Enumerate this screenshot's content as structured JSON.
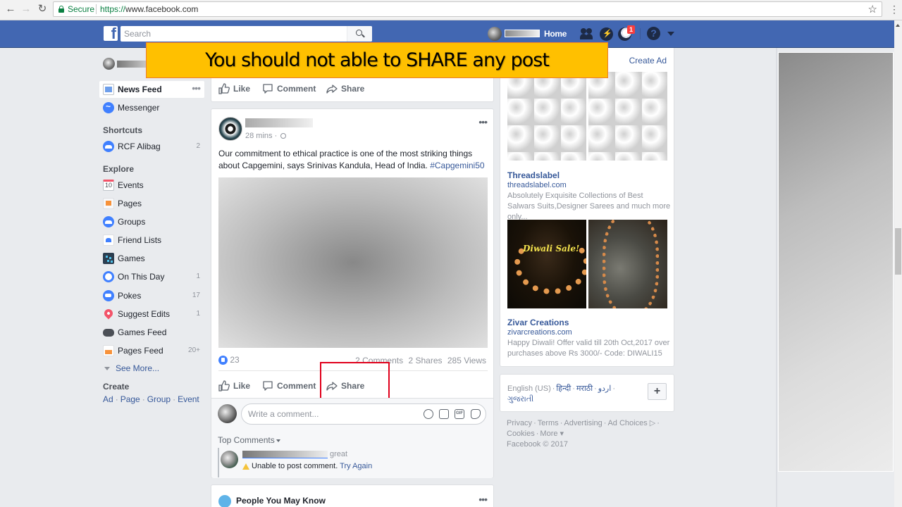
{
  "browser": {
    "secure_label": "Secure",
    "url_scheme": "https://",
    "url_rest": "www.facebook.com"
  },
  "header": {
    "search_placeholder": "Search",
    "home_label": "Home",
    "notifications_count": "1",
    "icons": [
      "friend-requests-icon",
      "messenger-icon",
      "notifications-globe-icon",
      "help-icon",
      "account-caret-icon"
    ]
  },
  "annotation": {
    "text": "You should not able to SHARE any post",
    "background": "#ffc000",
    "highlight_color": "#e0001b"
  },
  "sidebar": {
    "items": [
      {
        "label": "News Feed",
        "icon": "newsfeed-icon",
        "count": ""
      },
      {
        "label": "Messenger",
        "icon": "messenger-icon",
        "count": ""
      }
    ],
    "shortcuts_title": "Shortcuts",
    "shortcuts": [
      {
        "label": "RCF Alibag",
        "icon": "group-icon",
        "count": "2"
      }
    ],
    "explore_title": "Explore",
    "explore": [
      {
        "label": "Events",
        "icon": "calendar-icon",
        "icon_text": "10",
        "count": ""
      },
      {
        "label": "Pages",
        "icon": "flag-icon",
        "count": ""
      },
      {
        "label": "Groups",
        "icon": "groups-icon",
        "count": ""
      },
      {
        "label": "Friend Lists",
        "icon": "friend-lists-icon",
        "count": ""
      },
      {
        "label": "Games",
        "icon": "games-icon",
        "count": ""
      },
      {
        "label": "On This Day",
        "icon": "history-icon",
        "count": "1"
      },
      {
        "label": "Pokes",
        "icon": "poke-icon",
        "count": "17"
      },
      {
        "label": "Suggest Edits",
        "icon": "map-pin-icon",
        "count": "1"
      },
      {
        "label": "Games Feed",
        "icon": "gamepad-icon",
        "count": ""
      },
      {
        "label": "Pages Feed",
        "icon": "pages-feed-icon",
        "count": "20+"
      }
    ],
    "see_more": "See More...",
    "create_title": "Create",
    "create_links": [
      "Ad",
      "Page",
      "Group",
      "Event"
    ]
  },
  "actions": {
    "like": "Like",
    "comment": "Comment",
    "share": "Share"
  },
  "post": {
    "time": "28 mins",
    "separator": "·",
    "text": "Our commitment to ethical practice is one of the most striking things about Capgemini, says Srinivas Kandula, Head of India.",
    "hashtag": "#Capgemini50",
    "reactions_count": "23",
    "comments": "2 Comments",
    "shares": "2 Shares",
    "views": "285 Views",
    "comment_placeholder": "Write a comment...",
    "top_comments_label": "Top Comments",
    "failed_comment": {
      "text": "great",
      "error": "Unable to post comment.",
      "retry": "Try Again"
    }
  },
  "pymk": {
    "title": "People You May Know"
  },
  "ads": {
    "create_ad": "Create Ad",
    "items": [
      {
        "title": "Threadslabel",
        "domain": "threadslabel.com",
        "description": "Absolutely Exquisite Collections of Best Salwars Suits,Designer Sarees and much more only..."
      },
      {
        "title": "Zivar Creations",
        "domain": "zivarcreations.com",
        "description": "Happy Diwali! Offer valid till 20th Oct,2017 over purchases above Rs 3000/- Code: DIWALI15",
        "image_text": "Diwali Sale!"
      }
    ]
  },
  "languages": {
    "current": "English (US)",
    "others": [
      "हिन्दी",
      "मराठी",
      "اردو",
      "ગુજરાતી"
    ],
    "add_label": "+"
  },
  "footer": {
    "links": [
      "Privacy",
      "Terms",
      "Advertising",
      "Ad Choices",
      "Cookies",
      "More"
    ],
    "copyright": "Facebook © 2017"
  }
}
